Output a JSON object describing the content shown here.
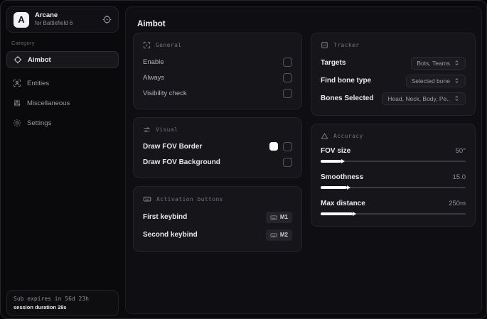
{
  "app": {
    "name": "Arcane",
    "subtitle": "for Battlefield 6",
    "logo_letter": "A"
  },
  "sidebar": {
    "category_label": "Category",
    "items": [
      {
        "label": "Aimbot",
        "icon": "crosshair-icon",
        "active": true
      },
      {
        "label": "Entities",
        "icon": "entity-scan-icon",
        "active": false
      },
      {
        "label": "Miscellaneous",
        "icon": "sliders-vertical-icon",
        "active": false
      },
      {
        "label": "Settings",
        "icon": "gear-icon",
        "active": false
      }
    ],
    "subscription": {
      "expires": "Sub expires in 56d 23h",
      "session": "session duration 28s"
    }
  },
  "main": {
    "title": "Aimbot",
    "general": {
      "title": "General",
      "rows": [
        {
          "label": "Enable",
          "checked": false
        },
        {
          "label": "Always",
          "checked": false
        },
        {
          "label": "Visibility check",
          "checked": false
        }
      ]
    },
    "visual": {
      "title": "Visual",
      "rows": [
        {
          "label": "Draw FOV Border",
          "swatch_color": "#ffffff",
          "checked": false
        },
        {
          "label": "Draw FOV Background",
          "checked": false
        }
      ]
    },
    "activation": {
      "title": "Activation buttons",
      "rows": [
        {
          "label": "First keybind",
          "key": "M1"
        },
        {
          "label": "Second keybind",
          "key": "M2"
        }
      ]
    },
    "tracker": {
      "title": "Tracker",
      "rows": [
        {
          "label": "Targets",
          "value": "Bots, Teams"
        },
        {
          "label": "Find bone type",
          "value": "Selected bone"
        },
        {
          "label": "Bones Selected",
          "value": "Head, Neck, Body, Pe.."
        }
      ]
    },
    "accuracy": {
      "title": "Accuracy",
      "rows": [
        {
          "label": "FOV size",
          "value": "50°",
          "percent": 14
        },
        {
          "label": "Smoothness",
          "value": "15.0",
          "percent": 18
        },
        {
          "label": "Max distance",
          "value": "250m",
          "percent": 22
        }
      ]
    }
  }
}
